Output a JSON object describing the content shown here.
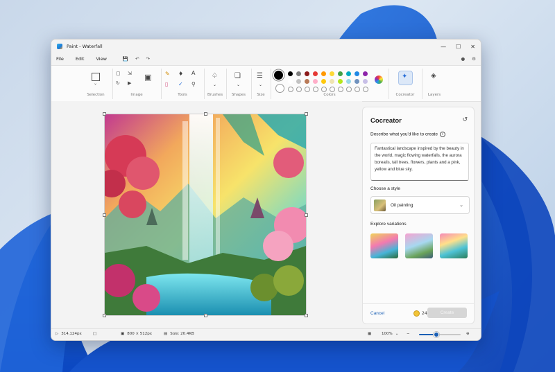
{
  "window": {
    "title": "Paint - Waterfall"
  },
  "menu": {
    "file": "File",
    "edit": "Edit",
    "view": "View"
  },
  "ribbon": {
    "groups": {
      "selection": "Selection",
      "image": "Image",
      "tools": "Tools",
      "brushes": "Brushes",
      "shapes": "Shapes",
      "size": "Size",
      "colors": "Colors",
      "cocreator": "Cocreator",
      "layers": "Layers"
    },
    "text_tool_glyph": "A",
    "palette_row1": [
      "#000000",
      "#7f7f7f",
      "#8b1a1a",
      "#e53935",
      "#ff9800",
      "#fdd835",
      "#43a047",
      "#00acc1",
      "#1e88e5",
      "#8e24aa"
    ],
    "palette_row2": [
      "#ffffff",
      "#c3c3c3",
      "#b97a57",
      "#ffaec9",
      "#ffc90e",
      "#efe4b0",
      "#b5e61d",
      "#99d9ea",
      "#7092be",
      "#c8bfe7"
    ],
    "primary_color": "#000000",
    "secondary_color": "#ffffff"
  },
  "cocreator": {
    "title": "Cocreator",
    "describe_label": "Describe what you'd like to create",
    "prompt": "Fantastical landscape inspired by the beauty in the world, magic flowing waterfalls, the aurora borealis, tall trees, flowers, plants and a pink, yellow and blue sky.",
    "style_label": "Choose a style",
    "style_value": "Oil painting",
    "variations_label": "Explore variations",
    "cancel": "Cancel",
    "credits": "24",
    "create": "Create"
  },
  "status": {
    "cursor": "314,124px",
    "canvas_size": "800 × 512px",
    "file_size": "Size: 20.4KB",
    "zoom": "100%",
    "zoom_fraction": 0.4
  }
}
